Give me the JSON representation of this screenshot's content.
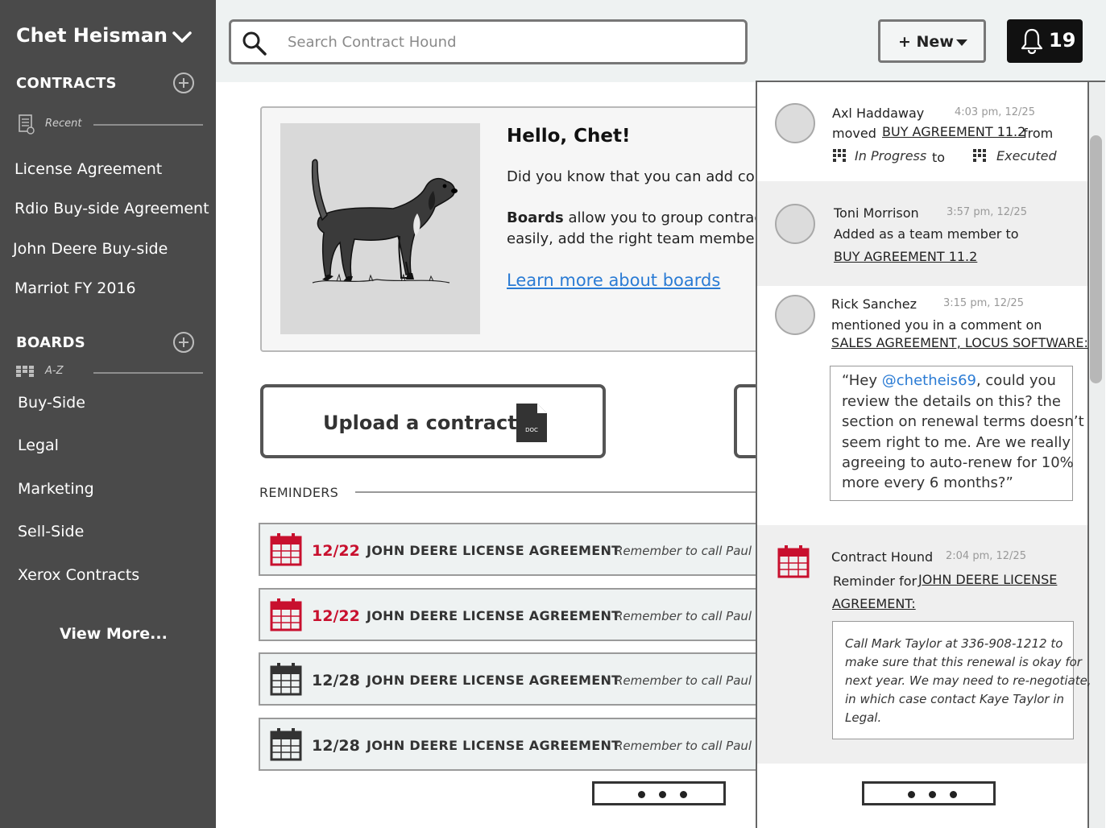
{
  "sidebar": {
    "user_name": "Chet Heisman",
    "contracts_title": "CONTRACTS",
    "contracts_sub": "Recent",
    "contracts": [
      "License Agreement",
      "Rdio Buy-side Agreement",
      "John Deere Buy-side",
      "Marriot FY 2016"
    ],
    "boards_title": "BOARDS",
    "boards_sub": "A-Z",
    "boards": [
      "Buy-Side",
      "Legal",
      "Marketing",
      "Sell-Side",
      "Xerox Contracts"
    ],
    "view_more": "View More..."
  },
  "topbar": {
    "search_placeholder": "Search Contract Hound",
    "new_label": "+ New",
    "notification_count": "19"
  },
  "hello": {
    "title": "Hello, Chet!",
    "line1": "Did you know that you can add con",
    "line2_bold": "Boards",
    "line2_rest": " allow you to group contract",
    "line3": "easily, add the right team members",
    "link": "Learn more about boards"
  },
  "upload": {
    "label": "Upload a contract",
    "doc_tag": "DOC"
  },
  "reminders": {
    "title": "REMINDERS",
    "items": [
      {
        "date": "12/22",
        "name": "JOHN DEERE LICENSE AGREEMENT",
        "note": "Remember to call Paul W",
        "color": "#c8102e"
      },
      {
        "date": "12/22",
        "name": "JOHN DEERE LICENSE AGREEMENT",
        "note": "Remember to call Paul W",
        "color": "#c8102e"
      },
      {
        "date": "12/28",
        "name": "JOHN DEERE LICENSE AGREEMENT",
        "note": "Remember to call Paul W",
        "color": "#333333"
      },
      {
        "date": "12/28",
        "name": "JOHN DEERE LICENSE AGREEMENT",
        "note": "Remember to call Paul W",
        "color": "#333333"
      }
    ]
  },
  "notifications": {
    "n1": {
      "name": "Axl Haddaway",
      "time": "4:03 pm, 12/25",
      "verb": "moved",
      "link": "BUY AGREEMENT 11.2",
      "from": "from",
      "status_from": "In Progress",
      "to": "to",
      "status_to": "Executed"
    },
    "n2": {
      "name": "Toni Morrison",
      "time": "3:57 pm, 12/25",
      "text": "Added as a team member to",
      "link": "BUY AGREEMENT 11.2"
    },
    "n3": {
      "name": "Rick Sanchez",
      "time": "3:15 pm, 12/25",
      "text": "mentioned you in a comment on",
      "link": "SALES AGREEMENT, LOCUS SOFTWARE:",
      "quote_start": "“Hey ",
      "mention": "@chetheis69",
      "quote_rest": ", could you",
      "quote_lines": [
        "review the details on this? the",
        "section on renewal terms doesn’t",
        "seem right to me. Are we really",
        "agreeing to auto-renew for 10%",
        "more every 6 months?”"
      ]
    },
    "n4": {
      "name": "Contract Hound",
      "time": "2:04 pm, 12/25",
      "text": "Reminder for",
      "link1": "JOHN DEERE LICENSE",
      "link2": "AGREEMENT:",
      "note_lines": [
        "Call Mark Taylor at 336-908-1212 to",
        "make sure that this renewal is okay for",
        "next year. We may need to re-negotiate,",
        "in which case contact Kaye Taylor in",
        "Legal."
      ]
    }
  },
  "colors": {
    "sidebar_bg": "#4a4a4a",
    "accent_red": "#c8102e",
    "link_blue": "#2a7bd4",
    "topbar_bg": "#eef2f2"
  }
}
